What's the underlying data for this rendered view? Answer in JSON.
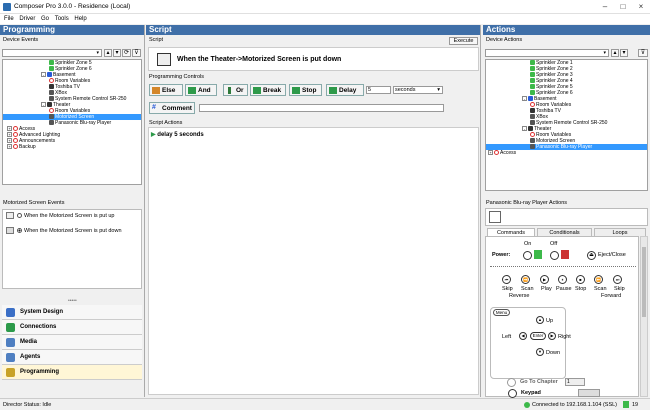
{
  "window": {
    "title": "Composer Pro 3.0.0 - Residence (Local)"
  },
  "menu": [
    "File",
    "Driver",
    "Go",
    "Tools",
    "Help"
  ],
  "left": {
    "title": "Programming",
    "device_events_label": "Device Events",
    "tree": [
      {
        "label": "Sprinkler Zone 5",
        "indent": 46,
        "icon": "green"
      },
      {
        "label": "Sprinkler Zone 6",
        "indent": 46,
        "icon": "green"
      },
      {
        "label": "Basement",
        "indent": 38,
        "icon": "blue",
        "exp": "-"
      },
      {
        "label": "Room Variables",
        "indent": 46,
        "icon": "red"
      },
      {
        "label": "Toshiba TV",
        "indent": 46,
        "icon": "tv"
      },
      {
        "label": "XBox",
        "indent": 46,
        "icon": "dev"
      },
      {
        "label": "System Remote Control SR-250",
        "indent": 46,
        "icon": "dev"
      },
      {
        "label": "Theater",
        "indent": 38,
        "icon": "tv",
        "exp": "-"
      },
      {
        "label": "Room Variables",
        "indent": 46,
        "icon": "red"
      },
      {
        "label": "Motorized Screen",
        "indent": 46,
        "icon": "dev",
        "selected": true
      },
      {
        "label": "Panasonic Blu-ray Player",
        "indent": 46,
        "icon": "dev"
      },
      {
        "label": "Access",
        "indent": 4,
        "icon": "red",
        "exp": "+"
      },
      {
        "label": "Advanced Lighting",
        "indent": 4,
        "icon": "red",
        "exp": "+"
      },
      {
        "label": "Announcements",
        "indent": 4,
        "icon": "red",
        "exp": "+"
      },
      {
        "label": "Backup",
        "indent": 4,
        "icon": "red",
        "exp": "+"
      }
    ],
    "events_label": "Motorized Screen Events",
    "events": [
      {
        "label": "When the Motorized Screen is put up",
        "checked": false
      },
      {
        "label": "When the Motorized Screen is put down",
        "checked": true
      }
    ],
    "nav": [
      {
        "label": "System Design",
        "color": "#3b6fc6"
      },
      {
        "label": "Connections",
        "color": "#2c9a4a"
      },
      {
        "label": "Media",
        "color": "#4f7fc1"
      },
      {
        "label": "Agents",
        "color": "#4f7fc1"
      },
      {
        "label": "Programming",
        "color": "#c8a227"
      }
    ]
  },
  "middle": {
    "title": "Script",
    "script_label": "Script",
    "execute": "Execute",
    "script_title": "When the Theater->Motorized Screen is put down",
    "controls_label": "Programming Controls",
    "buttons": {
      "else": "Else",
      "and": "And",
      "or": "Or",
      "break": "Break",
      "stop": "Stop",
      "delay": "Delay",
      "comment": "Comment"
    },
    "delay_value": "5",
    "delay_unit": "seconds",
    "actions_label": "Script Actions",
    "action_item": "delay 5 seconds"
  },
  "right": {
    "title": "Actions",
    "device_actions_label": "Device Actions",
    "tree": [
      {
        "label": "Sprinkler Zone 1",
        "indent": 44,
        "icon": "green"
      },
      {
        "label": "Sprinkler Zone 2",
        "indent": 44,
        "icon": "green"
      },
      {
        "label": "Sprinkler Zone 3",
        "indent": 44,
        "icon": "green"
      },
      {
        "label": "Sprinkler Zone 4",
        "indent": 44,
        "icon": "green"
      },
      {
        "label": "Sprinkler Zone 5",
        "indent": 44,
        "icon": "green"
      },
      {
        "label": "Sprinkler Zone 6",
        "indent": 44,
        "icon": "green"
      },
      {
        "label": "Basement",
        "indent": 36,
        "icon": "blue",
        "exp": "-"
      },
      {
        "label": "Room Variables",
        "indent": 44,
        "icon": "red"
      },
      {
        "label": "Toshiba TV",
        "indent": 44,
        "icon": "tv"
      },
      {
        "label": "XBox",
        "indent": 44,
        "icon": "dev"
      },
      {
        "label": "System Remote Control SR-250",
        "indent": 44,
        "icon": "dev"
      },
      {
        "label": "Theater",
        "indent": 36,
        "icon": "tv",
        "exp": "-"
      },
      {
        "label": "Room Variables",
        "indent": 44,
        "icon": "red"
      },
      {
        "label": "Motorized Screen",
        "indent": 44,
        "icon": "dev"
      },
      {
        "label": "Panasonic Blu-ray Player",
        "indent": 44,
        "icon": "dev",
        "selected": true
      },
      {
        "label": "Access",
        "indent": 2,
        "icon": "red",
        "exp": "+"
      }
    ],
    "player_actions_label": "Panasonic Blu-ray Player Actions",
    "tabs": [
      "Commands",
      "Conditionals",
      "Loops"
    ],
    "power_label": "Power:",
    "on_label": "On",
    "off_label": "Off",
    "eject_label": "Eject/Close",
    "transport": [
      {
        "label": "Skip",
        "sub": ""
      },
      {
        "label": "Scan",
        "sub": ""
      },
      {
        "label": "Play",
        "sub": ""
      },
      {
        "label": "Pause",
        "sub": ""
      },
      {
        "label": "Stop",
        "sub": ""
      },
      {
        "label": "Scan",
        "sub": ""
      },
      {
        "label": "Skip",
        "sub": ""
      }
    ],
    "reverse_label": "Reverse",
    "forward_label": "Forward",
    "menu_label": "Menu",
    "up_label": "Up",
    "left_label": "Left",
    "enter_label": "Enter",
    "right_label": "Right",
    "down_label": "Down",
    "keypad_label": "Keypad",
    "goto_label": "Go To Chapter",
    "goto_value": "1"
  },
  "status": {
    "left": "Director Status: Idle",
    "connection": "Connected to 192.168.1.104 (SSL)",
    "count": "19"
  }
}
